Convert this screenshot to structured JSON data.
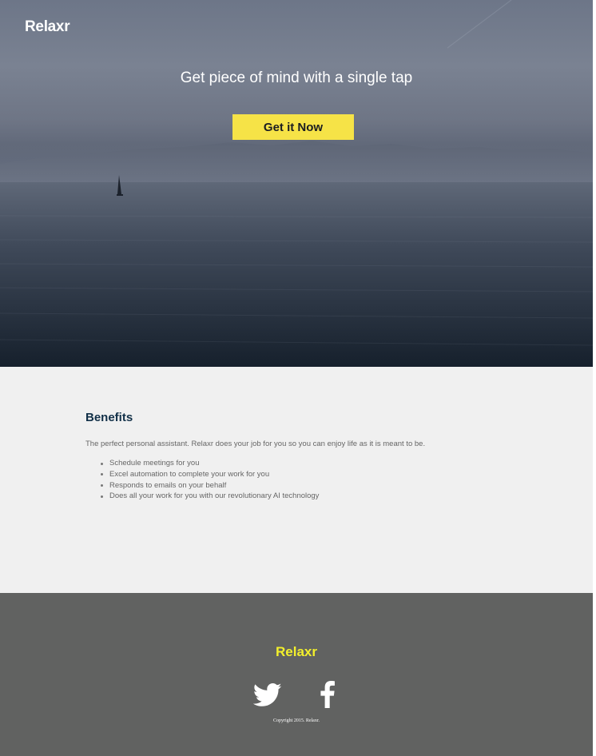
{
  "header": {
    "logo": "Relaxr"
  },
  "hero": {
    "tagline": "Get piece of mind with a single tap",
    "cta_label": "Get it Now",
    "cta_color": "#f6e347"
  },
  "benefits": {
    "title": "Benefits",
    "description": "The perfect personal assistant. Relaxr does your job for you so you can enjoy life as it is meant to be.",
    "items": [
      "Schedule meetings for you",
      "Excel automation to complete your work for you",
      "Responds to emails on your behalf",
      "Does all your work for you with our revolutionary AI technology"
    ]
  },
  "footer": {
    "logo": "Relaxr",
    "logo_color": "#f2ef2c",
    "social": [
      {
        "icon": "twitter-icon"
      },
      {
        "icon": "facebook-icon"
      }
    ],
    "copyright": "Copyright 2015. Relaxr."
  }
}
